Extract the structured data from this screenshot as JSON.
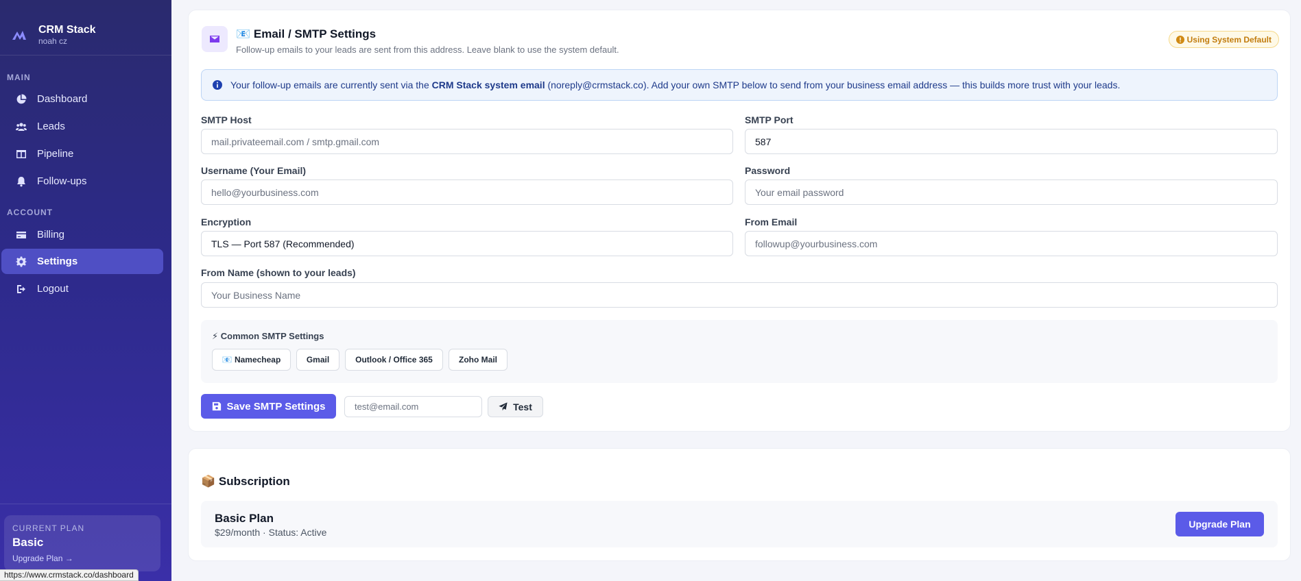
{
  "brand": {
    "title": "CRM Stack",
    "subtitle": "noah cz"
  },
  "sidebar": {
    "section_main": "MAIN",
    "section_account": "ACCOUNT",
    "items": [
      {
        "label": "Dashboard",
        "icon": "chart-pie-icon"
      },
      {
        "label": "Leads",
        "icon": "users-icon"
      },
      {
        "label": "Pipeline",
        "icon": "columns-icon"
      },
      {
        "label": "Follow-ups",
        "icon": "bell-icon"
      },
      {
        "label": "Billing",
        "icon": "credit-card-icon"
      },
      {
        "label": "Settings",
        "icon": "gear-icon",
        "active": true
      },
      {
        "label": "Logout",
        "icon": "logout-icon"
      }
    ],
    "plan": {
      "label": "CURRENT PLAN",
      "name": "Basic",
      "link": "Upgrade Plan →"
    }
  },
  "statusbar": {
    "url": "https://www.crmstack.co/dashboard"
  },
  "smtp": {
    "title": "📧 Email / SMTP Settings",
    "subtitle": "Follow-up emails to your leads are sent from this address. Leave blank to use the system default.",
    "badge": "Using System Default",
    "info": {
      "prefix": "Your follow-up emails are currently sent via the ",
      "bold": "CRM Stack system email",
      "suffix": " (noreply@crmstack.co). Add your own SMTP below to send from your business email address — this builds more trust with your leads."
    },
    "fields": {
      "host": {
        "label": "SMTP Host",
        "placeholder": "mail.privateemail.com / smtp.gmail.com"
      },
      "port": {
        "label": "SMTP Port",
        "value": "587"
      },
      "username": {
        "label": "Username (Your Email)",
        "placeholder": "hello@yourbusiness.com"
      },
      "password": {
        "label": "Password",
        "placeholder": "Your email password"
      },
      "encryption": {
        "label": "Encryption",
        "value": "TLS — Port 587 (Recommended)"
      },
      "from_email": {
        "label": "From Email",
        "placeholder": "followup@yourbusiness.com"
      },
      "from_name": {
        "label": "From Name (shown to your leads)",
        "placeholder": "Your Business Name"
      }
    },
    "presets": {
      "title": "⚡ Common SMTP Settings",
      "items": [
        "📧 Namecheap",
        "Gmail",
        "Outlook / Office 365",
        "Zoho Mail"
      ]
    },
    "save_label": "Save SMTP Settings",
    "test_placeholder": "test@email.com",
    "test_label": "Test"
  },
  "subscription": {
    "title": "📦 Subscription",
    "plan_name": "Basic Plan",
    "plan_meta": "$29/month · Status: Active",
    "upgrade_label": "Upgrade Plan"
  }
}
